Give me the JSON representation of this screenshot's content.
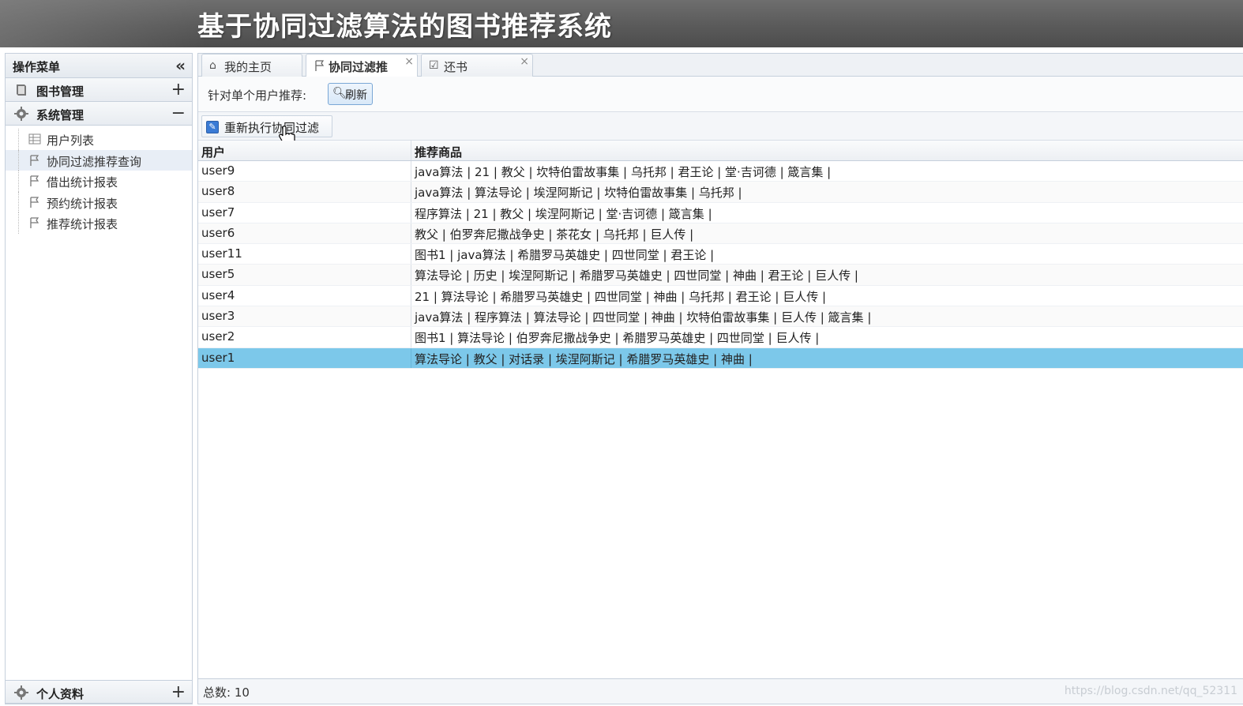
{
  "header": {
    "title": "基于协同过滤算法的图书推荐系统"
  },
  "sidebar": {
    "title": "操作菜单",
    "panels": [
      {
        "label": "图书管理",
        "toggle": "+"
      },
      {
        "label": "系统管理",
        "toggle": "−"
      }
    ],
    "items": [
      {
        "label": "用户列表"
      },
      {
        "label": "协同过滤推荐查询"
      },
      {
        "label": "借出统计报表"
      },
      {
        "label": "预约统计报表"
      },
      {
        "label": "推荐统计报表"
      }
    ],
    "footer": {
      "label": "个人资料",
      "toggle": "+"
    }
  },
  "tabs": [
    {
      "label": "我的主页",
      "icon": "home-icon",
      "closable": false
    },
    {
      "label": "协同过滤推",
      "icon": "flag-icon",
      "closable": true
    },
    {
      "label": "还书",
      "icon": "checkbox-icon",
      "closable": true
    }
  ],
  "toolbar": {
    "filter_label": "针对单个用户推荐:",
    "refresh_label": "刷新",
    "rerun_label": "重新执行协同过滤"
  },
  "grid": {
    "columns": [
      "用户",
      "推荐商品"
    ],
    "rows": [
      {
        "user": "user9",
        "rec": "java算法 | 21 | 教父 | 坎特伯雷故事集 | 乌托邦 | 君王论 | 堂·吉诃德 | 箴言集 |"
      },
      {
        "user": "user8",
        "rec": "java算法 | 算法导论 | 埃涅阿斯记 | 坎特伯雷故事集 | 乌托邦 |"
      },
      {
        "user": "user7",
        "rec": "程序算法 | 21 | 教父 | 埃涅阿斯记 | 堂·吉诃德 | 箴言集 |"
      },
      {
        "user": "user6",
        "rec": "教父 | 伯罗奔尼撒战争史 | 茶花女 | 乌托邦 | 巨人传 |"
      },
      {
        "user": "user11",
        "rec": "图书1 | java算法 | 希腊罗马英雄史 | 四世同堂 | 君王论 |"
      },
      {
        "user": "user5",
        "rec": "算法导论 | 历史 | 埃涅阿斯记 | 希腊罗马英雄史 | 四世同堂 | 神曲 | 君王论 | 巨人传 |"
      },
      {
        "user": "user4",
        "rec": "21 | 算法导论 | 希腊罗马英雄史 | 四世同堂 | 神曲 | 乌托邦 | 君王论 | 巨人传 |"
      },
      {
        "user": "user3",
        "rec": "java算法 | 程序算法 | 算法导论 | 四世同堂 | 神曲 | 坎特伯雷故事集 | 巨人传 | 箴言集 |"
      },
      {
        "user": "user2",
        "rec": "图书1 | 算法导论 | 伯罗奔尼撒战争史 | 希腊罗马英雄史 | 四世同堂 | 巨人传 |"
      },
      {
        "user": "user1",
        "rec": "算法导论 | 教父 | 对话录 | 埃涅阿斯记 | 希腊罗马英雄史 | 神曲 |"
      }
    ],
    "selected_user": "user1"
  },
  "pager": {
    "total_label": "总数: 10"
  },
  "watermark": "https://blog.csdn.net/qq_52311"
}
